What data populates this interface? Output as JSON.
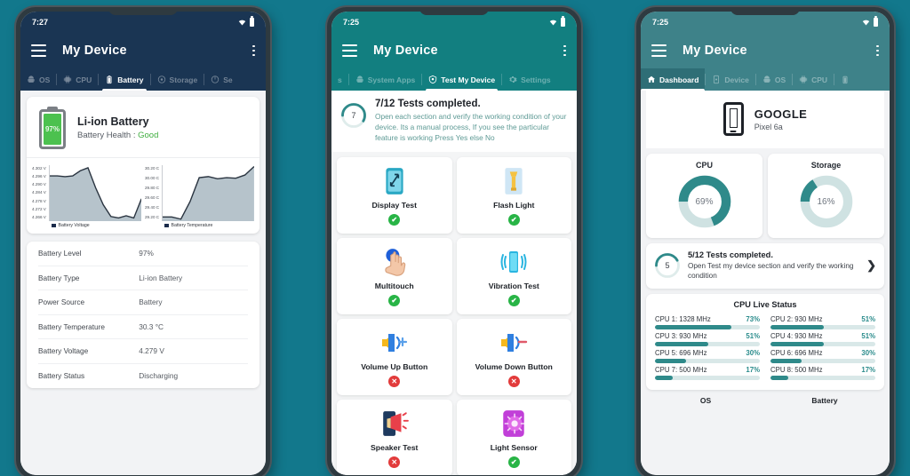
{
  "phone1": {
    "status": {
      "time": "7:27"
    },
    "appbar": {
      "title": "My Device"
    },
    "tabs": [
      {
        "label": "OS",
        "icon": "android-icon",
        "active": false
      },
      {
        "label": "CPU",
        "icon": "cpu-icon",
        "active": false
      },
      {
        "label": "Battery",
        "icon": "battery-icon",
        "active": true
      },
      {
        "label": "Storage",
        "icon": "storage-icon",
        "active": false
      },
      {
        "label": "Se",
        "icon": "sensors-icon",
        "active": false
      }
    ],
    "battery": {
      "level_label": "97%",
      "title": "Li-ion Battery",
      "health_label": "Battery Health :",
      "health_value": "Good"
    },
    "chart_data": [
      {
        "type": "area",
        "title": "Battery Voltage",
        "legend": "Battery Voltage",
        "ylabel": "",
        "yticks": [
          "4.302 V",
          "4.296 V",
          "4.290 V",
          "4.284 V",
          "4.278 V",
          "4.272 V",
          "4.266 V"
        ],
        "ylim": [
          4.266,
          4.302
        ],
        "x": [
          0,
          1,
          2,
          3,
          4,
          5,
          6,
          7,
          8,
          9,
          10,
          11,
          12
        ],
        "values": [
          4.296,
          4.296,
          4.2955,
          4.296,
          4.2995,
          4.3015,
          4.288,
          4.2765,
          4.2685,
          4.2675,
          4.269,
          4.2675,
          4.2805
        ],
        "grid": false,
        "legend_position": "bottom"
      },
      {
        "type": "area",
        "title": "Battery Temperature",
        "legend": "Battery Temperature",
        "ylabel": "",
        "yticks": [
          "30.20 C",
          "30.00 C",
          "29.80 C",
          "29.60 C",
          "29.40 C",
          "29.20 C"
        ],
        "ylim": [
          29.2,
          30.2
        ],
        "x": [
          0,
          1,
          2,
          3,
          4,
          5,
          6,
          7,
          8,
          9,
          10
        ],
        "values": [
          29.26,
          29.26,
          29.22,
          29.55,
          30.0,
          30.02,
          29.98,
          30.0,
          29.99,
          30.05,
          30.21
        ],
        "grid": false,
        "legend_position": "bottom"
      }
    ],
    "info_rows": [
      {
        "key": "Battery Level",
        "value": "97%"
      },
      {
        "key": "Battery Type",
        "value": "Li-ion Battery"
      },
      {
        "key": "Power Source",
        "value": "Battery"
      },
      {
        "key": "Battery Temperature",
        "value": "30.3 °C"
      },
      {
        "key": "Battery Voltage",
        "value": "4.279 V"
      },
      {
        "key": "Battery Status",
        "value": "Discharging"
      }
    ]
  },
  "phone2": {
    "status": {
      "time": "7:25"
    },
    "appbar": {
      "title": "My Device"
    },
    "tabs": [
      {
        "label": "s",
        "icon": "apps-icon",
        "active": false
      },
      {
        "label": "System Apps",
        "icon": "android-icon",
        "active": false
      },
      {
        "label": "Test My Device",
        "icon": "shield-icon",
        "active": true
      },
      {
        "label": "Settings",
        "icon": "gear-icon",
        "active": false
      }
    ],
    "summary": {
      "count": "7",
      "headline": "7/12 Tests completed.",
      "description": "Open each section and verify the working condition of your device. Its a manual process, If you see the particular feature is working Press Yes else No",
      "progress_pct": 58
    },
    "tests": [
      {
        "label": "Display Test",
        "icon": "display-test-icon",
        "status": "pass"
      },
      {
        "label": "Flash Light",
        "icon": "flashlight-icon",
        "status": "pass"
      },
      {
        "label": "Multitouch",
        "icon": "multitouch-icon",
        "status": "pass"
      },
      {
        "label": "Vibration Test",
        "icon": "vibration-icon",
        "status": "pass"
      },
      {
        "label": "Volume Up Button",
        "icon": "volume-up-icon",
        "status": "fail"
      },
      {
        "label": "Volume Down Button",
        "icon": "volume-down-icon",
        "status": "fail"
      },
      {
        "label": "Speaker Test",
        "icon": "speaker-icon",
        "status": "fail"
      },
      {
        "label": "Light Sensor",
        "icon": "light-sensor-icon",
        "status": "pass"
      }
    ],
    "marks": {
      "pass": "✔",
      "fail": "✕"
    }
  },
  "phone3": {
    "status": {
      "time": "7:25"
    },
    "appbar": {
      "title": "My Device"
    },
    "tabs": [
      {
        "label": "Dashboard",
        "icon": "home-icon",
        "active": true
      },
      {
        "label": "Device",
        "icon": "device-icon",
        "active": false
      },
      {
        "label": "OS",
        "icon": "android-icon",
        "active": false
      },
      {
        "label": "CPU",
        "icon": "cpu-icon",
        "active": false
      },
      {
        "label": "",
        "icon": "battery-icon",
        "active": false
      }
    ],
    "device": {
      "brand": "GOOGLE",
      "model": "Pixel 6a"
    },
    "chart_data": [
      {
        "type": "pie",
        "title": "CPU",
        "value": 69,
        "value_label": "69%",
        "colors": {
          "fill": "#2f8a8a",
          "track": "#cfe2e2"
        }
      },
      {
        "type": "pie",
        "title": "Storage",
        "value": 16,
        "value_label": "16%",
        "colors": {
          "fill": "#2f8a8a",
          "track": "#cfe2e2"
        }
      }
    ],
    "tests_summary": {
      "count": "5",
      "headline": "5/12 Tests completed.",
      "description": "Open Test my device section and verify the working condition",
      "progress_pct": 42,
      "chevron": "❯"
    },
    "cpu_live": {
      "title": "CPU Live Status",
      "cores": [
        {
          "label": "CPU 1: 1328 MHz",
          "pct": "73%",
          "value": 73
        },
        {
          "label": "CPU 2: 930 MHz",
          "pct": "51%",
          "value": 51
        },
        {
          "label": "CPU 3: 930 MHz",
          "pct": "51%",
          "value": 51
        },
        {
          "label": "CPU 4: 930 MHz",
          "pct": "51%",
          "value": 51
        },
        {
          "label": "CPU 5: 696 MHz",
          "pct": "30%",
          "value": 30
        },
        {
          "label": "CPU 6: 696 MHz",
          "pct": "30%",
          "value": 30
        },
        {
          "label": "CPU 7: 500 MHz",
          "pct": "17%",
          "value": 17
        },
        {
          "label": "CPU 8: 500 MHz",
          "pct": "17%",
          "value": 17
        }
      ]
    },
    "bottom_row": [
      "OS",
      "Battery"
    ]
  },
  "colors": {
    "background": "#12788c",
    "phone1_header": "#1a3553",
    "phone2_header": "#127f80",
    "phone3_header": "#3e8289",
    "accent_teal": "#2f8a8a",
    "pass_green": "#28b446",
    "fail_red": "#e23b3b",
    "battery_green": "#4cc14f"
  }
}
